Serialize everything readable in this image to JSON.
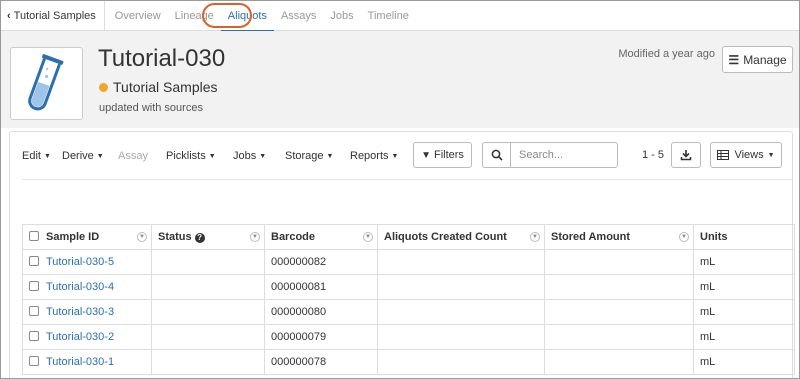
{
  "nav": {
    "back_label": "Tutorial Samples",
    "tabs": [
      {
        "label": "Overview"
      },
      {
        "label": "Lineage"
      },
      {
        "label": "Aliquots"
      },
      {
        "label": "Assays"
      },
      {
        "label": "Jobs"
      },
      {
        "label": "Timeline"
      }
    ],
    "active_tab": "Aliquots"
  },
  "header": {
    "title": "Tutorial-030",
    "sample_type": "Tutorial Samples",
    "sample_type_color": "#f1a62b",
    "description": "updated with sources",
    "modified": "Modified a year ago",
    "manage_label": "Manage"
  },
  "toolbar": {
    "menus": [
      {
        "label": "Edit"
      },
      {
        "label": "Derive"
      },
      {
        "label": "Assay"
      },
      {
        "label": "Picklists"
      },
      {
        "label": "Jobs"
      },
      {
        "label": "Storage"
      },
      {
        "label": "Reports"
      }
    ],
    "filters_label": "Filters",
    "search_placeholder": "Search...",
    "paging": "1 - 5",
    "views_label": "Views"
  },
  "table": {
    "columns": [
      "Sample ID",
      "Status",
      "Barcode",
      "Aliquots Created Count",
      "Stored Amount",
      "Units"
    ],
    "rows": [
      {
        "sample_id": "Tutorial-030-5",
        "status": "",
        "barcode": "000000082",
        "aliquots": "",
        "stored": "",
        "units": "mL"
      },
      {
        "sample_id": "Tutorial-030-4",
        "status": "",
        "barcode": "000000081",
        "aliquots": "",
        "stored": "",
        "units": "mL"
      },
      {
        "sample_id": "Tutorial-030-3",
        "status": "",
        "barcode": "000000080",
        "aliquots": "",
        "stored": "",
        "units": "mL"
      },
      {
        "sample_id": "Tutorial-030-2",
        "status": "",
        "barcode": "000000079",
        "aliquots": "",
        "stored": "",
        "units": "mL"
      },
      {
        "sample_id": "Tutorial-030-1",
        "status": "",
        "barcode": "000000078",
        "aliquots": "",
        "stored": "",
        "units": "mL"
      }
    ]
  },
  "colors": {
    "accent": "#2a6fb0",
    "highlight": "#d9622b"
  }
}
